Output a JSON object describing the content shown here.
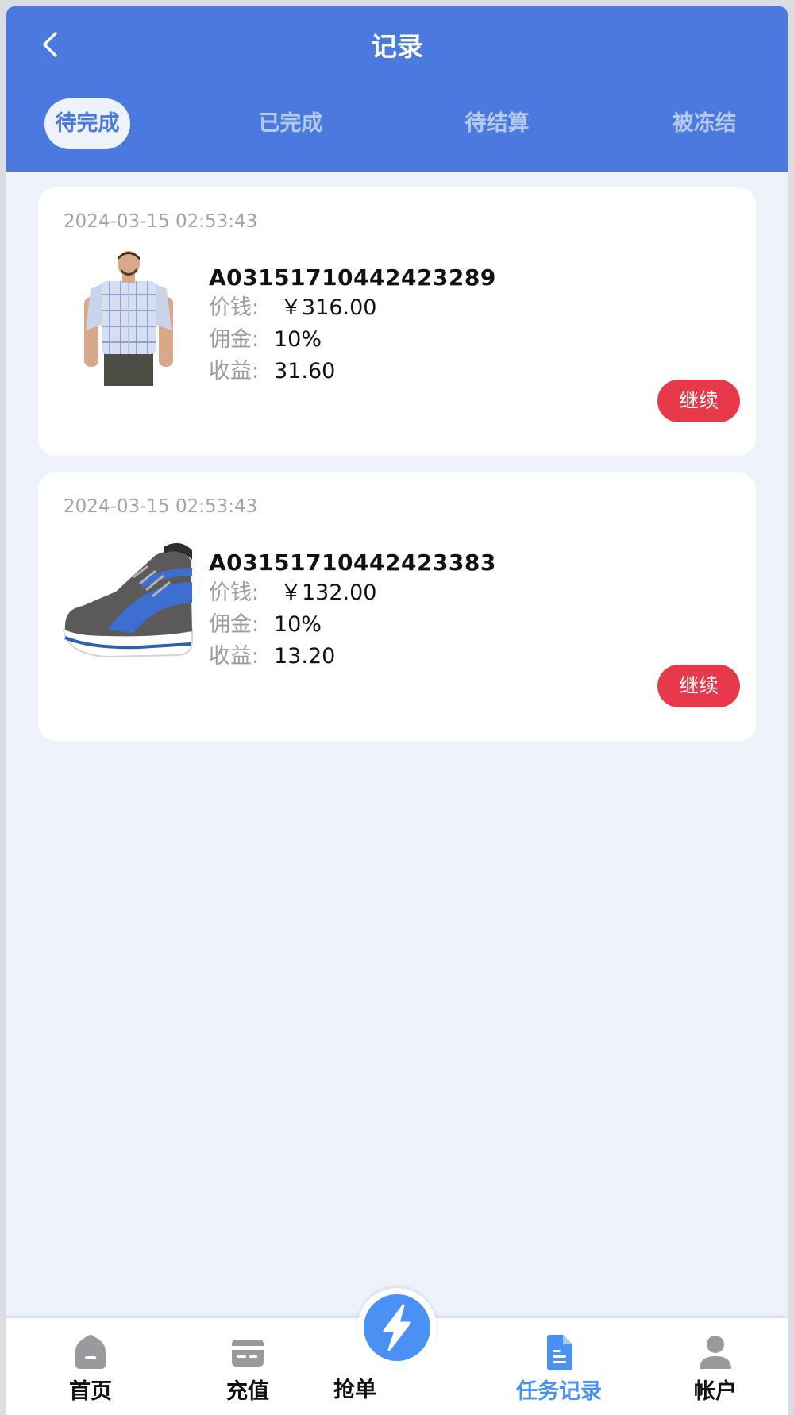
{
  "header": {
    "title": "记录"
  },
  "tabs": [
    {
      "label": "待完成"
    },
    {
      "label": "已完成"
    },
    {
      "label": "待结算"
    },
    {
      "label": "被冻结"
    }
  ],
  "active_tab": "待完成",
  "orders": [
    {
      "time": "2024-03-15 02:53:43",
      "order_id": "A03151710442423289",
      "price_label": "价钱:",
      "price": "￥316.00",
      "commission_label": "佣金:",
      "commission": "10%",
      "earnings_label": "收益:",
      "earnings": "31.60",
      "button_label": "继续",
      "image": "shirt-product-image"
    },
    {
      "time": "2024-03-15 02:53:43",
      "order_id": "A03151710442423383",
      "price_label": "价钱:",
      "price": "￥132.00",
      "commission_label": "佣金:",
      "commission": "10%",
      "earnings_label": "收益:",
      "earnings": "13.20",
      "button_label": "继续",
      "image": "sneaker-product-image"
    }
  ],
  "tabbar": [
    {
      "label": "首页",
      "icon": "home-icon"
    },
    {
      "label": "充值",
      "icon": "card-icon"
    },
    {
      "label": "抢单",
      "icon": "lightning-icon"
    },
    {
      "label": "任务记录",
      "icon": "document-icon"
    },
    {
      "label": "帐户",
      "icon": "user-icon"
    }
  ],
  "active_tabbar": "任务记录",
  "colors": {
    "header_bg": "#4a7ade",
    "page_bg": "#edf2fb",
    "accent": "#4a90f5",
    "button_red": "#e8394b",
    "muted_text": "#a3a3a3"
  }
}
